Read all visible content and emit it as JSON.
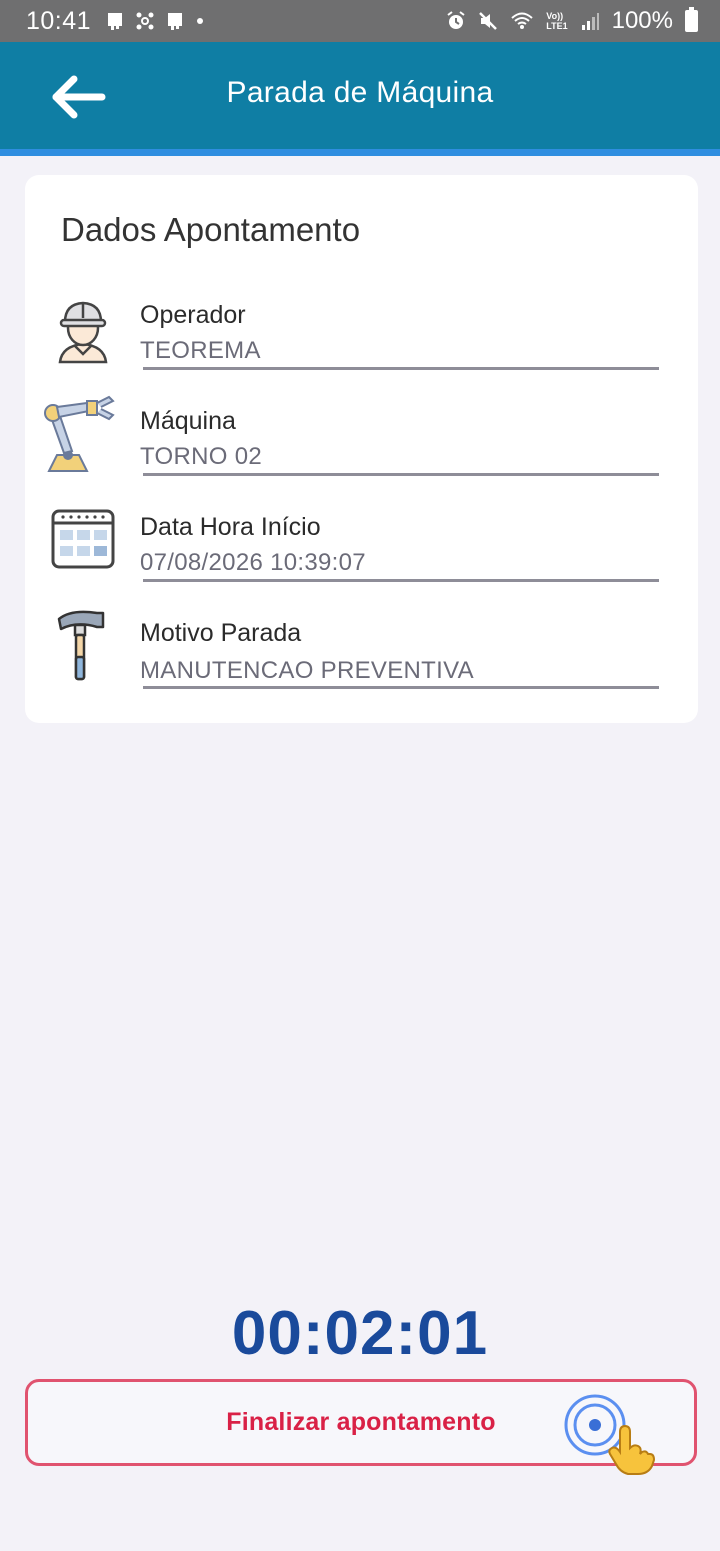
{
  "status_bar": {
    "time": "10:41",
    "battery_text": "100%",
    "left_icons": [
      "notification-icon",
      "network-hub-icon",
      "notification-icon",
      "dot-icon"
    ],
    "right_icons": [
      "alarm-icon",
      "mute-icon",
      "wifi-icon",
      "volte-icon",
      "signal-icon",
      "battery-icon"
    ],
    "volte_label": "Vo))",
    "lte_label": "LTE1"
  },
  "app_bar": {
    "title": "Parada de Máquina",
    "back_icon": "arrow-left-icon",
    "color": "#0f7ea4",
    "accent_color": "#2f8ee0"
  },
  "card": {
    "title": "Dados Apontamento",
    "fields": [
      {
        "icon": "worker-helmet-icon",
        "label": "Operador",
        "value": "TEOREMA"
      },
      {
        "icon": "robotic-arm-icon",
        "label": "Máquina",
        "value": "TORNO 02"
      },
      {
        "icon": "calendar-icon",
        "label": "Data Hora Início",
        "value": "07/08/2026 10:39:07"
      },
      {
        "icon": "hammer-icon",
        "label": "Motivo Parada",
        "value": "MANUTENCAO PREVENTIVA"
      }
    ]
  },
  "timer": {
    "value": "00:02:01",
    "color": "#1a4a9b"
  },
  "finish_button": {
    "label": "Finalizar apontamento",
    "color": "#d92146"
  }
}
